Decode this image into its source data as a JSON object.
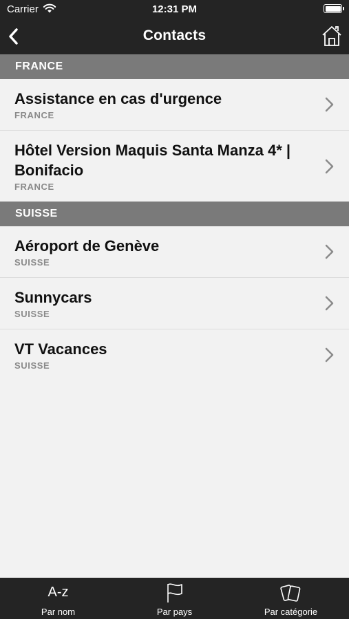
{
  "status_bar": {
    "carrier": "Carrier",
    "time": "12:31 PM"
  },
  "nav": {
    "title": "Contacts"
  },
  "sections": [
    {
      "header": "FRANCE",
      "items": [
        {
          "name": "Assistance en cas d'urgence",
          "country": "FRANCE"
        },
        {
          "name": "Hôtel Version Maquis Santa Manza 4* | Bonifacio",
          "country": "FRANCE"
        }
      ]
    },
    {
      "header": "SUISSE",
      "items": [
        {
          "name": "Aéroport de Genève",
          "country": "SUISSE"
        },
        {
          "name": "Sunnycars",
          "country": "SUISSE"
        },
        {
          "name": "VT Vacances",
          "country": "SUISSE"
        }
      ]
    }
  ],
  "tabs": [
    {
      "icon": "A-z",
      "label": "Par nom"
    },
    {
      "icon": "flag-icon",
      "label": "Par pays"
    },
    {
      "icon": "cards-icon",
      "label": "Par catégorie"
    }
  ],
  "colors": {
    "bar_background": "#242424",
    "section_header": "#7a7a7a",
    "list_background": "#f2f2f2"
  }
}
